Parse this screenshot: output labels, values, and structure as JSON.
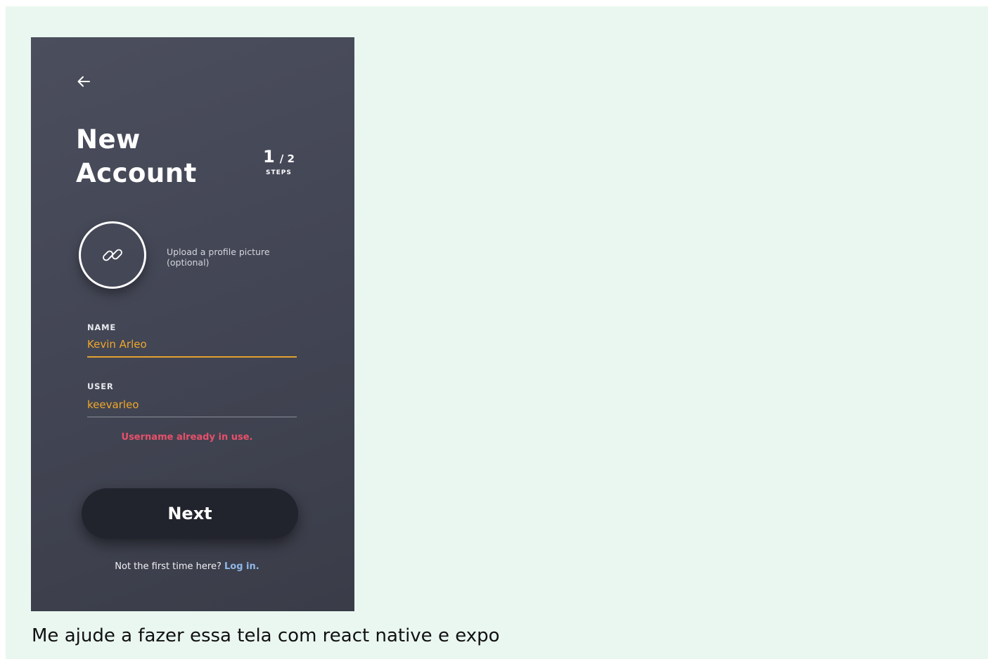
{
  "screen": {
    "title_line1": "New",
    "title_line2": "Account",
    "step_current": "1",
    "step_total": "2",
    "steps_label": "STEPS",
    "upload_text_line1": "Upload a profile picture",
    "upload_text_line2": "(optional)"
  },
  "form": {
    "name_label": "NAME",
    "name_value": "Kevin Arleo",
    "user_label": "USER",
    "user_value": "keevarleo",
    "error_message": "Username already in use."
  },
  "actions": {
    "next_label": "Next",
    "login_prompt": "Not the first time here?",
    "login_link": "Log in."
  },
  "caption": "Me ajude a fazer essa tela com react native e expo",
  "icons": {
    "back": "arrow-left-icon",
    "avatar": "link-icon"
  },
  "colors": {
    "accent": "#f0a82a",
    "error": "#e8506a",
    "link": "#8fb8e8",
    "button": "#22242d",
    "panel": "#434655",
    "outer_background": "#eaf7f0"
  }
}
